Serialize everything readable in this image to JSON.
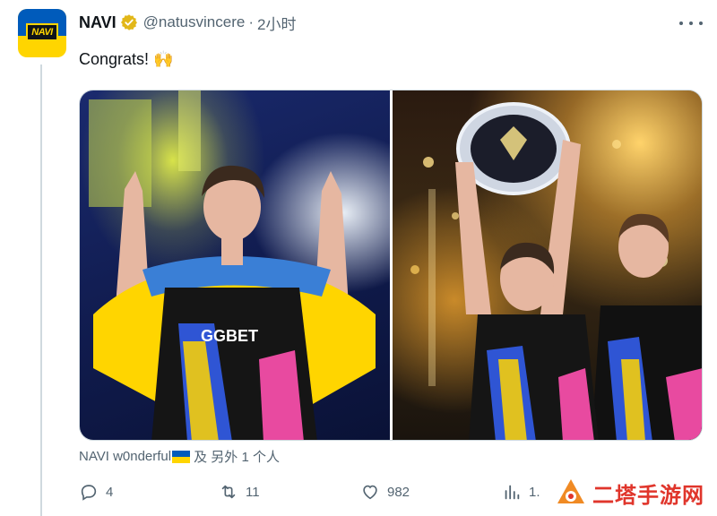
{
  "tweet": {
    "author_name": "NAVI",
    "handle": "@natusvincere",
    "separator": "·",
    "time": "2小时",
    "avatar_logo_text": "NAVI",
    "text": "Congrats! 🙌",
    "jersey_text": "GGBET"
  },
  "tagged": {
    "name": "NAVI w0nderful",
    "suffix": "及 另外 1 个人"
  },
  "actions": {
    "replies": "4",
    "reposts": "11",
    "likes": "982",
    "views": "1."
  },
  "watermark": {
    "text": "二塔手游网"
  },
  "colors": {
    "verified_gold": "#e2b719",
    "muted": "#536471",
    "flag_blue": "#005bbb",
    "flag_yellow": "#ffd500",
    "watermark_red": "#e0352b"
  },
  "icons": [
    "verified-badge-icon",
    "more-icon",
    "reply-icon",
    "repost-icon",
    "like-icon",
    "views-icon",
    "watermark-logo-icon"
  ]
}
